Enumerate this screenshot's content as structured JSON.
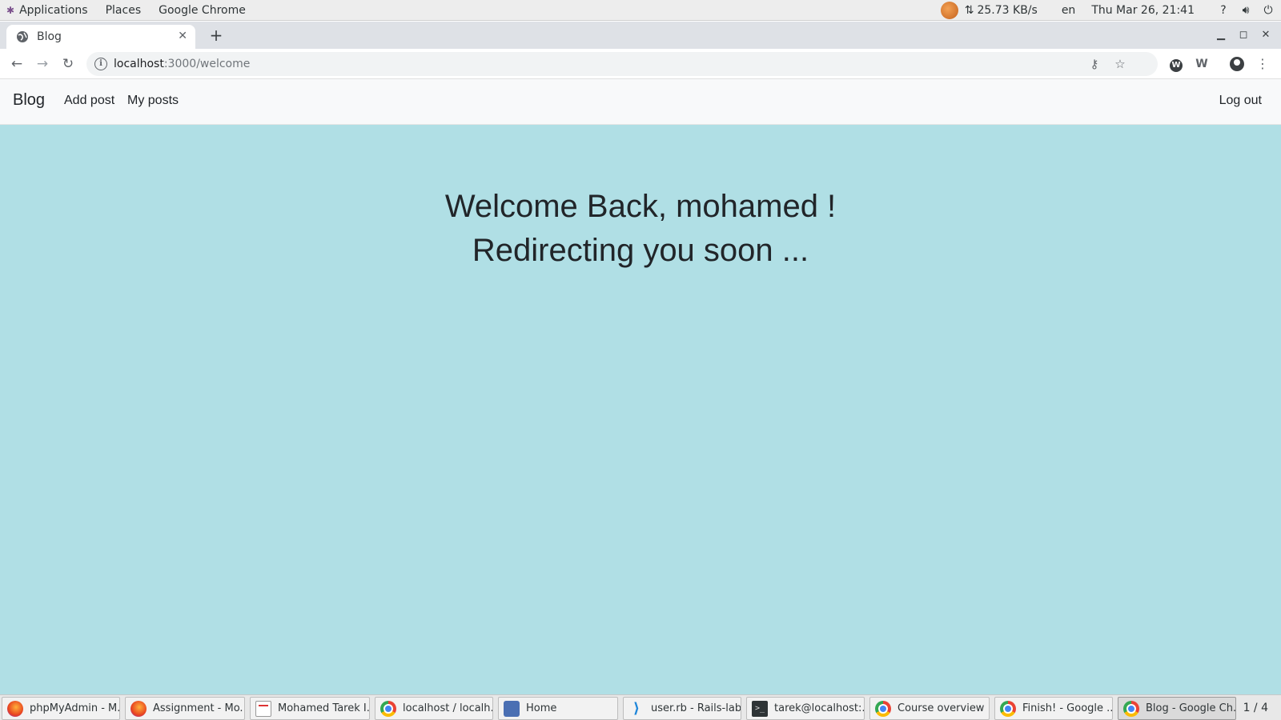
{
  "topbar": {
    "menus": [
      "Applications",
      "Places",
      "Google Chrome"
    ],
    "net_speed": "25.73 KB/s",
    "net_arrows": "⇅",
    "lang": "en",
    "clock": "Thu Mar 26, 21:41",
    "icons": [
      "help-icon",
      "volume-icon",
      "power-icon"
    ]
  },
  "browser": {
    "tab_title": "Blog",
    "url_host": "localhost",
    "url_path": ":3000/welcome"
  },
  "page": {
    "brand": "Blog",
    "nav": [
      "Add post",
      "My posts"
    ],
    "logout": "Log out",
    "welcome_line1": "Welcome Back, mohamed !",
    "welcome_line2": "Redirecting you soon ...",
    "background_color": "#b0dfe5"
  },
  "taskbar": {
    "items": [
      {
        "label": "phpMyAdmin - M...",
        "icon": "firefox"
      },
      {
        "label": "Assignment - Mo...",
        "icon": "firefox"
      },
      {
        "label": "Mohamed Tarek I...",
        "icon": "document"
      },
      {
        "label": "localhost / localh...",
        "icon": "chrome"
      },
      {
        "label": "Home",
        "icon": "files"
      },
      {
        "label": "user.rb - Rails-lab...",
        "icon": "vscode"
      },
      {
        "label": "tarek@localhost:...",
        "icon": "terminal"
      },
      {
        "label": "Course overview ...",
        "icon": "chrome"
      },
      {
        "label": "Finish! - Google ...",
        "icon": "chrome"
      },
      {
        "label": "Blog - Google Ch...",
        "icon": "chrome"
      }
    ],
    "workspace": "1 / 4"
  }
}
